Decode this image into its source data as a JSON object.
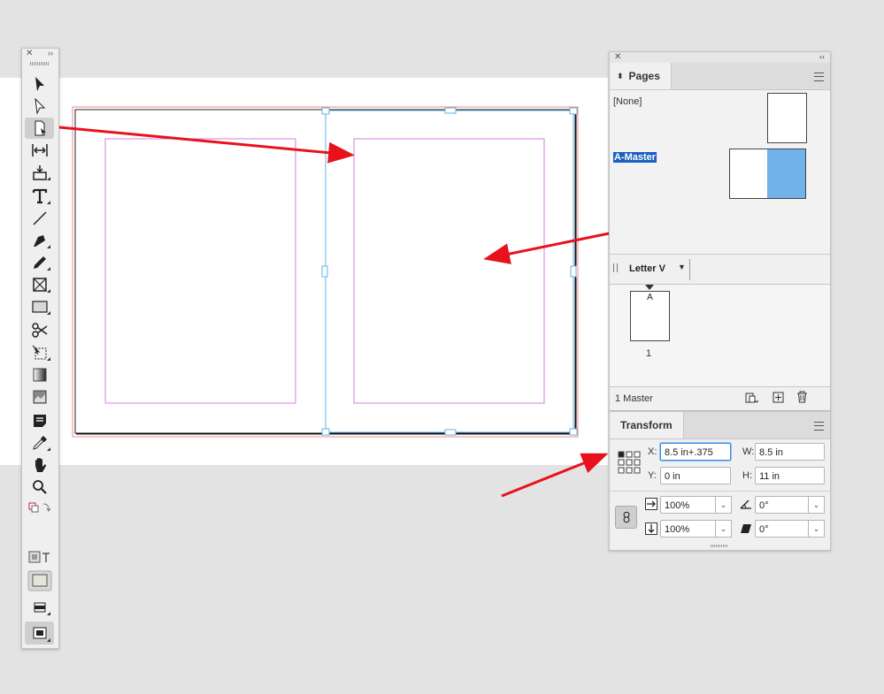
{
  "tools": {
    "selected": "page-tool"
  },
  "pages_panel": {
    "tab_label": "Pages",
    "none_label": "[None]",
    "master_label": "A-Master",
    "page_size_label": "Letter V",
    "page_prefix": "A",
    "page_number": "1",
    "footer_count": "1 Master",
    "highlight_color": "#1d5fbf",
    "selected_page_color": "#72b2ea"
  },
  "transform_panel": {
    "tab_label": "Transform",
    "x_label": "X:",
    "x_value": "8.5 in+.375",
    "y_label": "Y:",
    "y_value": "0 in",
    "w_label": "W:",
    "w_value": "8.5 in",
    "h_label": "H:",
    "h_value": "11 in",
    "scale_x": "100%",
    "scale_y": "100%",
    "rotation": "0°",
    "shear": "0°"
  },
  "colors": {
    "annotation_arrow": "#e8121d",
    "margin_guide": "#d77ce3",
    "bleed_guide": "#f08a8a",
    "selection": "#5fb3e6"
  }
}
